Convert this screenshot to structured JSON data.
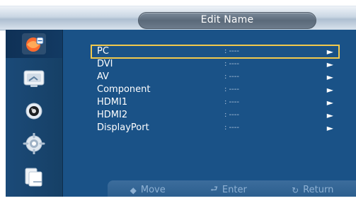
{
  "header": {
    "title": "Edit Name"
  },
  "sidebar": {
    "items": [
      {
        "icon": "picture-settings-icon"
      },
      {
        "icon": "display-icon"
      },
      {
        "icon": "sound-icon"
      },
      {
        "icon": "setup-icon"
      },
      {
        "icon": "multi-window-icon"
      }
    ]
  },
  "list": {
    "rows": [
      {
        "name": "PC",
        "value": ": ----",
        "arrow": "►"
      },
      {
        "name": "DVI",
        "value": ": ----",
        "arrow": "►"
      },
      {
        "name": "AV",
        "value": ": ----",
        "arrow": "►"
      },
      {
        "name": "Component",
        "value": ": ----",
        "arrow": "►"
      },
      {
        "name": "HDMI1",
        "value": ": ----",
        "arrow": "►"
      },
      {
        "name": "HDMI2",
        "value": ": ----",
        "arrow": "►"
      },
      {
        "name": "DisplayPort",
        "value": ": ----",
        "arrow": "►"
      }
    ],
    "selected_index": 0
  },
  "footer": {
    "move_label": "Move",
    "enter_label": "Enter",
    "return_label": "Return",
    "move_icon": "◆",
    "enter_icon": "⮐",
    "return_icon": "↻"
  },
  "colors": {
    "panel": "#1a5287",
    "sidebar": "#1b4a78",
    "selection": "#f2c94c"
  }
}
